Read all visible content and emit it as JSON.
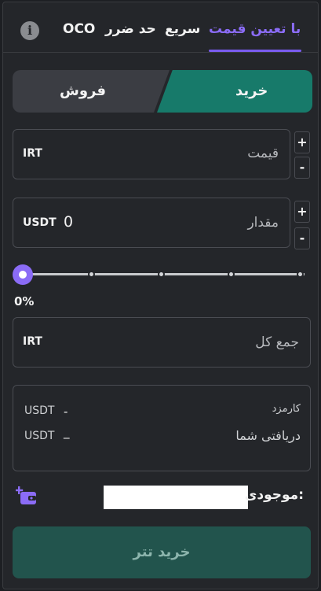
{
  "tabs": {
    "limit": "با تعیین قیمت",
    "market": "سریع",
    "stop": "حد ضرر",
    "oco": "OCO",
    "info_icon": "info-icon",
    "accent": "#7a5cf0"
  },
  "side": {
    "buy": "خرید",
    "sell": "فروش",
    "buy_color": "#177a6a"
  },
  "price": {
    "label": "قیمت",
    "unit": "IRT",
    "value": ""
  },
  "amount": {
    "label": "مقدار",
    "unit": "USDT",
    "value": "0"
  },
  "stepper": {
    "plus": "+",
    "minus": "-"
  },
  "slider": {
    "percent_label": "0%",
    "value": 0,
    "ticks": [
      0,
      25,
      50,
      75,
      100
    ]
  },
  "total": {
    "label": "جمع کل",
    "unit": "IRT",
    "value": ""
  },
  "fee": {
    "label": "کارمزد",
    "unit": "USDT",
    "value": "-"
  },
  "receive": {
    "label": "دریافتی شما",
    "unit": "USDT",
    "value": "_"
  },
  "balance": {
    "label": "موجودی:",
    "icon": "wallet-plus-icon"
  },
  "submit": {
    "label": "خرید تتر"
  }
}
